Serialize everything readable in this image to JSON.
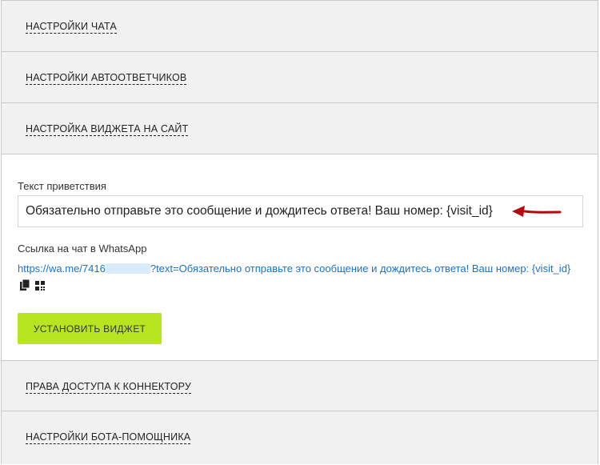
{
  "sections": [
    {
      "title": "НАСТРОЙКИ ЧАТА"
    },
    {
      "title": "НАСТРОЙКИ АВТООТВЕТЧИКОВ"
    },
    {
      "title": "НАСТРОЙКА ВИДЖЕТА НА САЙТ"
    },
    {
      "title": "ПРАВА ДОСТУПА К КОННЕКТОРУ"
    },
    {
      "title": "НАСТРОЙКИ БОТА-ПОМОЩНИКА"
    }
  ],
  "widget": {
    "greeting_label": "Текст приветствия",
    "greeting_value": "Обязательно отправьте это сообщение и дождитесь ответа! Ваш номер: {visit_id}",
    "link_label": "Ссылка на чат в WhatsApp",
    "link_prefix": "https://wa.me/7416",
    "link_suffix": "?text=Обязательно отправьте это сообщение и дождитесь ответа! Ваш номер: {visit_id}",
    "install_button": "УСТАНОВИТЬ ВИДЖЕТ"
  },
  "colors": {
    "accent_button": "#b7e51f",
    "link": "#1a73c8",
    "annotation_arrow": "#b3090f"
  },
  "icons": [
    "copy-icon",
    "qr-code-icon",
    "red-arrow-annotation"
  ]
}
